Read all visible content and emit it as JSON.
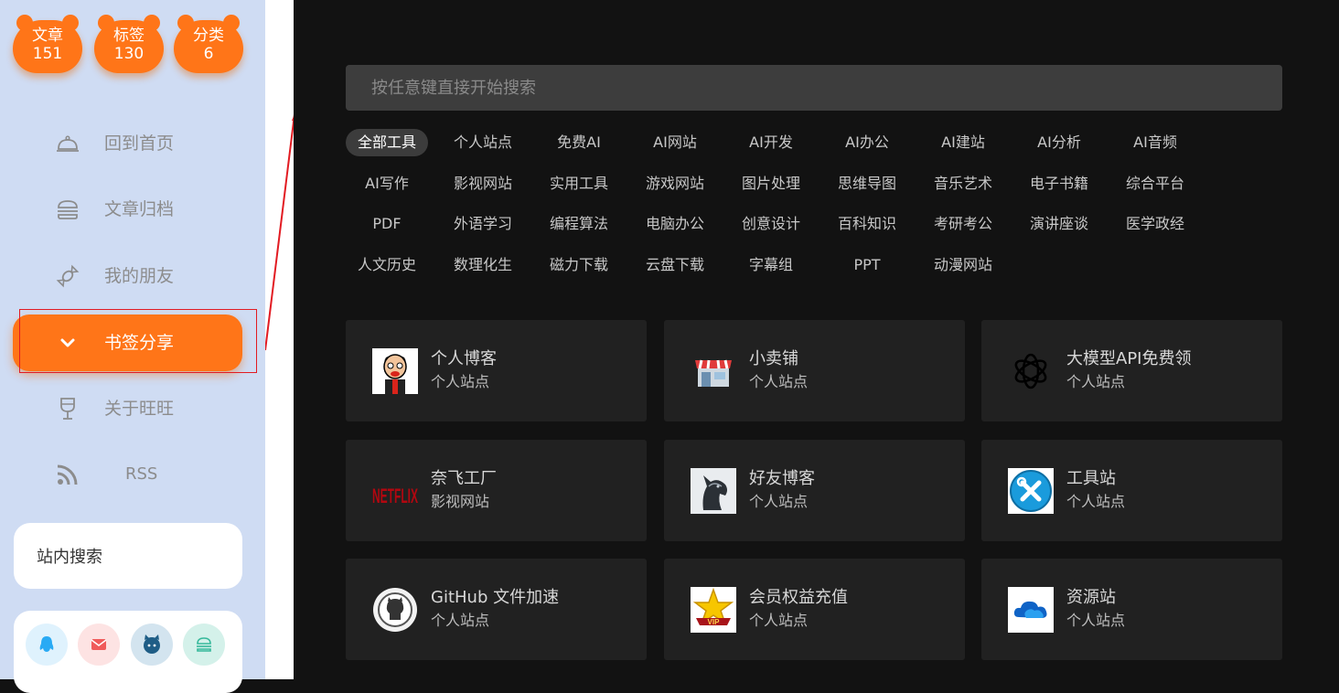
{
  "stats": [
    {
      "label": "文章",
      "value": "151"
    },
    {
      "label": "标签",
      "value": "130"
    },
    {
      "label": "分类",
      "value": "6"
    }
  ],
  "nav": [
    {
      "label": "回到首页",
      "icon": "cloche-icon"
    },
    {
      "label": "文章归档",
      "icon": "burger-icon"
    },
    {
      "label": "我的朋友",
      "icon": "candy-icon"
    },
    {
      "label": "书签分享",
      "icon": "chevron-down-icon",
      "active": true
    },
    {
      "label": "关于旺旺",
      "icon": "wine-glass-icon"
    },
    {
      "label": "RSS",
      "icon": "rss-icon"
    }
  ],
  "sidebar_search": {
    "label": "站内搜索"
  },
  "social": [
    {
      "icon": "qq-icon",
      "color": "#29aaf4"
    },
    {
      "icon": "mail-icon",
      "color": "#f05b5b"
    },
    {
      "icon": "github-icon",
      "color": "#1f5d86"
    },
    {
      "icon": "burger-icon",
      "color": "#36b99b"
    }
  ],
  "search": {
    "placeholder": "按任意键直接开始搜索"
  },
  "categories": [
    "全部工具",
    "个人站点",
    "免费AI",
    "AI网站",
    "AI开发",
    "AI办公",
    "AI建站",
    "AI分析",
    "AI音频",
    "AI写作",
    "影视网站",
    "实用工具",
    "游戏网站",
    "图片处理",
    "思维导图",
    "音乐艺术",
    "电子书籍",
    "综合平台",
    "PDF",
    "外语学习",
    "编程算法",
    "电脑办公",
    "创意设计",
    "百科知识",
    "考研考公",
    "演讲座谈",
    "医学政经",
    "人文历史",
    "数理化生",
    "磁力下载",
    "云盘下载",
    "字幕组",
    "PPT",
    "动漫网站"
  ],
  "active_category": "全部工具",
  "sites": [
    {
      "title": "个人博客",
      "category": "个人站点",
      "logo": "cartoon-avatar-logo"
    },
    {
      "title": "小卖铺",
      "category": "个人站点",
      "logo": "shop-logo"
    },
    {
      "title": "大模型API免费领",
      "category": "个人站点",
      "logo": "openai-logo"
    },
    {
      "title": "奈飞工厂",
      "category": "影视网站",
      "logo": "netflix-logo",
      "logo_text": "NETFLIX"
    },
    {
      "title": "好友博客",
      "category": "个人站点",
      "logo": "horse-logo"
    },
    {
      "title": "工具站",
      "category": "个人站点",
      "logo": "tools-logo"
    },
    {
      "title": "GitHub 文件加速",
      "category": "个人站点",
      "logo": "github-logo"
    },
    {
      "title": "会员权益充值",
      "category": "个人站点",
      "logo": "vip-star-logo",
      "logo_text": "VIP"
    },
    {
      "title": "资源站",
      "category": "个人站点",
      "logo": "onedrive-logo"
    }
  ],
  "colors": {
    "accent": "#ff7518",
    "sidebar_bg": "#cfdcf3",
    "main_bg": "#121212",
    "tile_bg": "#212121",
    "annotation": "#e21b22"
  }
}
